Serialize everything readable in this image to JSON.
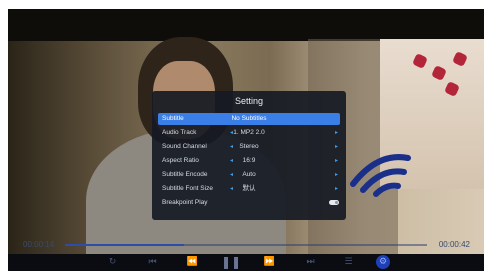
{
  "settings": {
    "title": "Setting",
    "rows": [
      {
        "label": "Subtitle",
        "value": "No Subtitles",
        "selected": true
      },
      {
        "label": "Audio Track",
        "value": "1. MP2 2.0"
      },
      {
        "label": "Sound Channel",
        "value": "Stereo"
      },
      {
        "label": "Aspect Ratio",
        "value": "16:9"
      },
      {
        "label": "Subtitle Encode",
        "value": "Auto"
      },
      {
        "label": "Subtitle Font Size",
        "value": "默认"
      },
      {
        "label": "Breakpoint Play",
        "toggle": "on"
      }
    ],
    "arrow_left": "◂",
    "arrow_right": "▸"
  },
  "player": {
    "current_time": "00:00:14",
    "total_time": "00:00:42",
    "progress": 0.33
  },
  "controls": {
    "repeat_icon": "↻",
    "first_icon": "⏮",
    "rewind_icon": "⏪",
    "play_pause_icon": "❚❚",
    "forward_icon": "⏩",
    "last_icon": "⏭",
    "menu_icon": "☰",
    "settings_icon": "⚙"
  },
  "colors": {
    "accent": "#3a7ee8",
    "panel": "#161a24",
    "controlbar": "#0a0c12"
  }
}
